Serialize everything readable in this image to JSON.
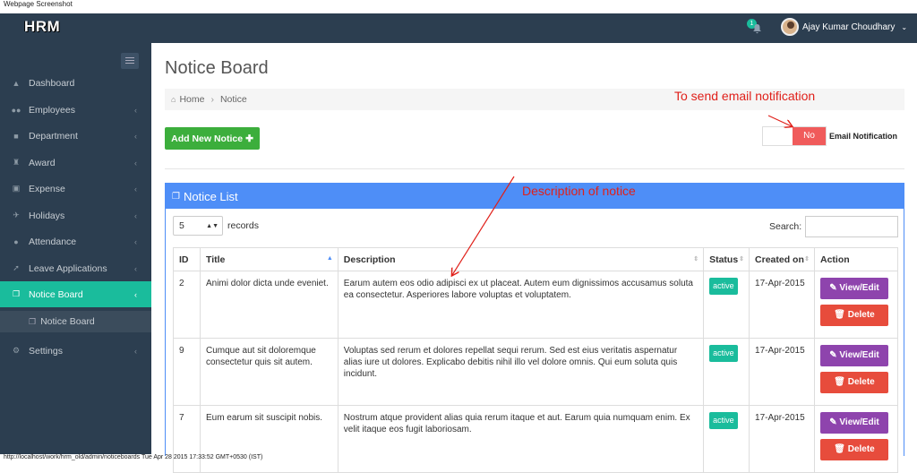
{
  "caption": "Webpage Screenshot",
  "footer": "http://localhost/work/hrm_old/admin/noticeboards Tue Apr 28 2015 17:33:52 GMT+0530 (IST)",
  "app": {
    "logo": "HRM",
    "notifications": "1",
    "user": "Ajay Kumar Choudhary"
  },
  "sidebar": {
    "items": [
      {
        "label": "Dashboard",
        "icon": "dashboard-icon"
      },
      {
        "label": "Employees",
        "icon": "users-icon"
      },
      {
        "label": "Department",
        "icon": "briefcase-icon"
      },
      {
        "label": "Award",
        "icon": "trophy-icon"
      },
      {
        "label": "Expense",
        "icon": "money-icon"
      },
      {
        "label": "Holidays",
        "icon": "plane-icon"
      },
      {
        "label": "Attendance",
        "icon": "user-icon"
      },
      {
        "label": "Leave Applications",
        "icon": "rocket-icon"
      },
      {
        "label": "Notice Board",
        "icon": "copy-icon"
      },
      {
        "label": "Settings",
        "icon": "cogs-icon"
      }
    ],
    "submenu": "Notice Board"
  },
  "page": {
    "title": "Notice Board",
    "breadcrumb": [
      "Home",
      "Notice"
    ],
    "add_button": "Add New Notice",
    "toggle_value": "No",
    "toggle_label": "Email Notification",
    "annotation_email": "To send email notification",
    "annotation_desc": "Description of notice"
  },
  "panel": {
    "title": "Notice List",
    "records_value": "5",
    "records_label": "records",
    "search_label": "Search:",
    "columns": [
      "ID",
      "Title",
      "Description",
      "Status",
      "Created on",
      "Action"
    ],
    "rows": [
      {
        "id": "2",
        "title": "Animi dolor dicta unde eveniet.",
        "description": "Earum autem eos odio adipisci ex ut placeat. Autem eum dignissimos accusamus soluta ea consectetur. Asperiores labore voluptas et voluptatem.",
        "status": "active",
        "created": "17-Apr-2015"
      },
      {
        "id": "9",
        "title": "Cumque aut sit doloremque consectetur quis sit autem.",
        "description": "Voluptas sed rerum et dolores repellat sequi rerum. Sed est eius veritatis aspernatur alias iure ut dolores. Explicabo debitis nihil illo vel dolore omnis. Qui eum soluta quis incidunt.",
        "status": "active",
        "created": "17-Apr-2015"
      },
      {
        "id": "7",
        "title": "Eum earum sit suscipit nobis.",
        "description": "Nostrum atque provident alias quia rerum itaque et aut. Earum quia numquam enim. Ex velit itaque eos fugit laboriosam.",
        "status": "active",
        "created": "17-Apr-2015"
      }
    ],
    "edit_label": "View/Edit",
    "delete_label": "Delete"
  }
}
